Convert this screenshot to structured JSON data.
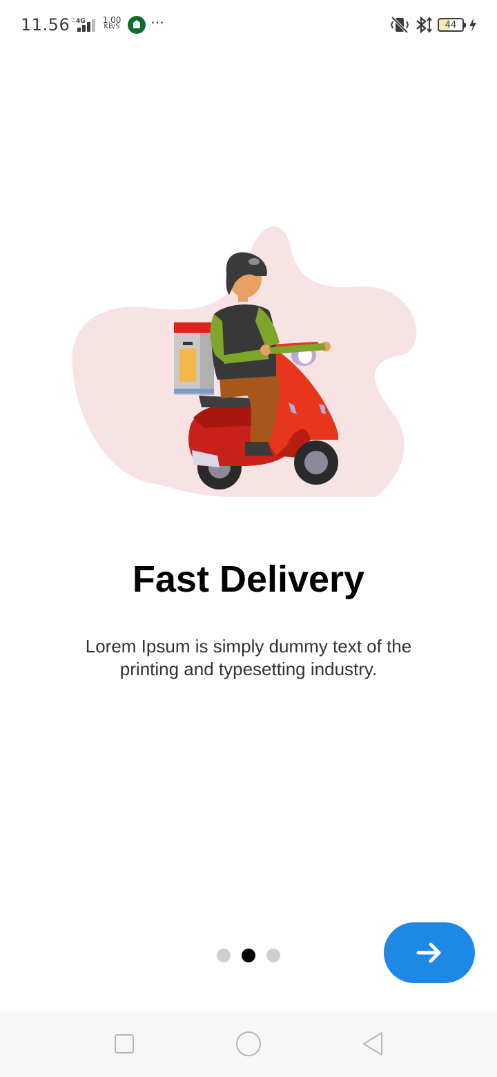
{
  "status_bar": {
    "time": "11.56",
    "network_type": "4G",
    "data_rate": "1.00",
    "data_unit": "KB/S",
    "battery_level": "44",
    "icons": [
      "signal-icon",
      "app-notification-icon",
      "more-dots-icon",
      "vibrate-icon",
      "bluetooth-icon",
      "battery-icon",
      "charging-icon"
    ]
  },
  "onboarding": {
    "illustration": "delivery-scooter-illustration",
    "title": "Fast Delivery",
    "description": "Lorem Ipsum is simply dummy text of the printing and typesetting industry.",
    "page_count": 3,
    "current_page": 2,
    "next_icon": "arrow-right-icon"
  },
  "colors": {
    "accent": "#1e88e5",
    "blob": "#f7e3e3",
    "dot_inactive": "#cfcfcf",
    "dot_active": "#000000"
  },
  "nav_bar": {
    "icons": [
      "recents-icon",
      "home-icon",
      "back-icon"
    ]
  }
}
